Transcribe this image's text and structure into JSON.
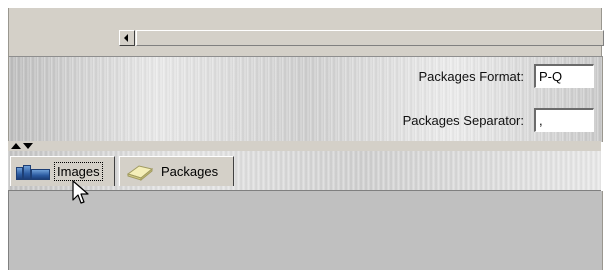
{
  "form": {
    "packages_format_label": "Packages Format:",
    "packages_format_value": "P-Q",
    "packages_separator_label": "Packages Separator:",
    "packages_separator_value": ","
  },
  "tabs": [
    {
      "label": "Images",
      "icon": "images-icon",
      "selected": true
    },
    {
      "label": "Packages",
      "icon": "package-icon",
      "selected": false
    }
  ],
  "cursor": {
    "icon": "arrow-cursor-icon"
  }
}
